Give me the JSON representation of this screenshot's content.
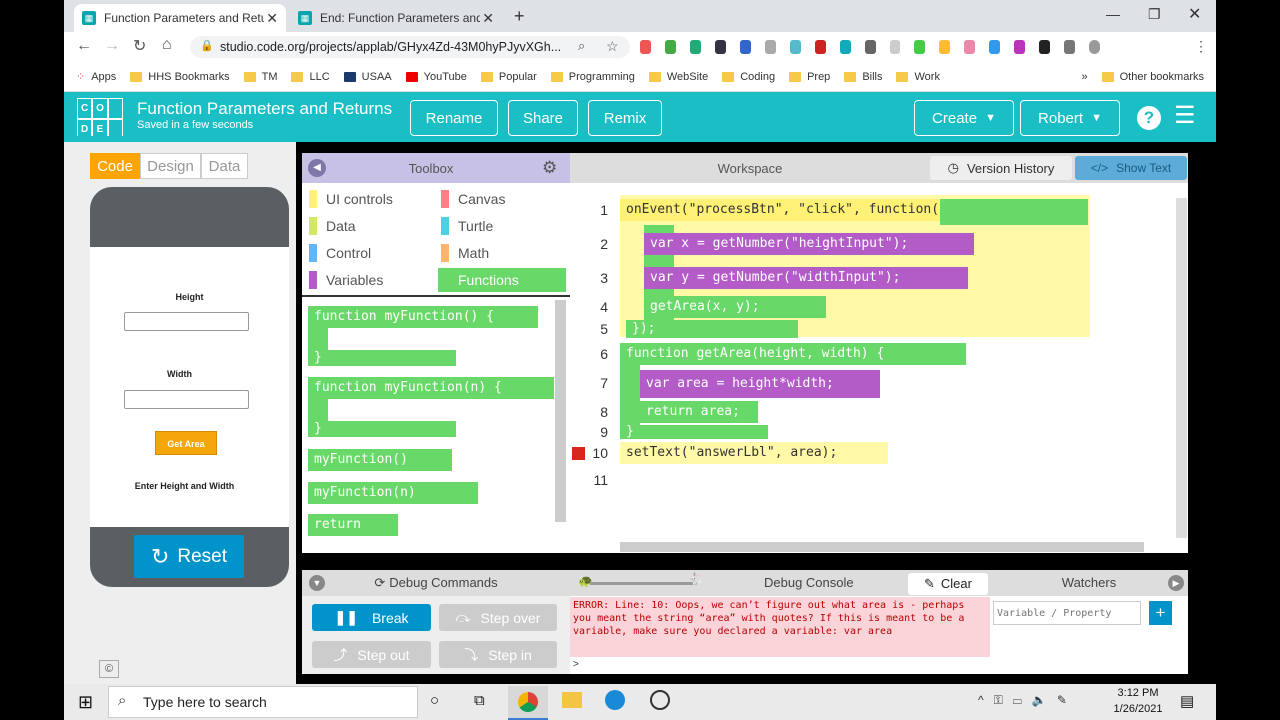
{
  "browser": {
    "tabs": [
      {
        "title": "Function Parameters and Returns"
      },
      {
        "title": "End: Function Parameters and Re"
      }
    ],
    "url": "studio.code.org/projects/applab/GHyx4Zd-43M0hyPJyvXGh...",
    "bookmarks": [
      "Apps",
      "HHS Bookmarks",
      "TM",
      "LLC",
      "USAA",
      "YouTube",
      "Popular",
      "Programming",
      "WebSite",
      "Coding",
      "Prep",
      "Bills",
      "Work"
    ],
    "other_bookmarks": "Other bookmarks"
  },
  "app": {
    "logo_letters": [
      "C",
      "O",
      "",
      "D",
      "E",
      ""
    ],
    "title": "Function Parameters and Returns",
    "subtitle": "Saved in a few seconds",
    "buttons": {
      "rename": "Rename",
      "share": "Share",
      "remix": "Remix",
      "create": "Create",
      "user": "Robert"
    }
  },
  "modes": {
    "code": "Code",
    "design": "Design",
    "data": "Data"
  },
  "phone": {
    "height_label": "Height",
    "width_label": "Width",
    "button": "Get Area",
    "answer": "Enter Height and Width",
    "reset": "Reset"
  },
  "toolbox": {
    "title": "Toolbox",
    "categories": [
      {
        "label": "UI controls",
        "color": "#fff176"
      },
      {
        "label": "Canvas",
        "color": "#f78183"
      },
      {
        "label": "Data",
        "color": "#d3e965"
      },
      {
        "label": "Turtle",
        "color": "#4dd0e1"
      },
      {
        "label": "Control",
        "color": "#64b5f6"
      },
      {
        "label": "Math",
        "color": "#fbb66c"
      },
      {
        "label": "Variables",
        "color": "#b35bc7"
      },
      {
        "label": "Functions",
        "color": "#68d868"
      }
    ],
    "blocks": [
      "function myFunction() {",
      "}",
      "function myFunction(n) {",
      "}",
      "myFunction()",
      "myFunction(n)",
      "return"
    ]
  },
  "workspace": {
    "title": "Workspace",
    "version_history": "Version History",
    "show_text": "Show Text",
    "lines": [
      {
        "n": "1",
        "code": "onEvent(\"processBtn\", \"click\", function( ) {"
      },
      {
        "n": "2",
        "code": "var x = getNumber(\"heightInput\");"
      },
      {
        "n": "3",
        "code": "var y = getNumber(\"widthInput\");"
      },
      {
        "n": "4",
        "code": "getArea(x, y);"
      },
      {
        "n": "5",
        "code": "});"
      },
      {
        "n": "6",
        "code": "function getArea(height, width) {"
      },
      {
        "n": "7",
        "code": "var area = height*width;"
      },
      {
        "n": "8",
        "code": "return area;"
      },
      {
        "n": "9",
        "code": "}"
      },
      {
        "n": "10",
        "code": "setText(\"answerLbl\", area);"
      },
      {
        "n": "11",
        "code": ""
      }
    ]
  },
  "debug": {
    "commands": "Debug Commands",
    "break": "Break",
    "step_over": "Step over",
    "step_out": "Step out",
    "step_in": "Step in",
    "console": "Debug Console",
    "clear": "Clear",
    "error": "ERROR: Line: 10: Oops, we can’t figure out what area is - perhaps you meant the string “area” with quotes? If this is meant to be a variable, make sure you declared a variable: var area",
    "prompt": ">",
    "watchers": "Watchers",
    "watch_placeholder": "Variable / Property"
  },
  "taskbar": {
    "search": "Type here to search",
    "time": "3:12 PM",
    "date": "1/26/2021"
  }
}
